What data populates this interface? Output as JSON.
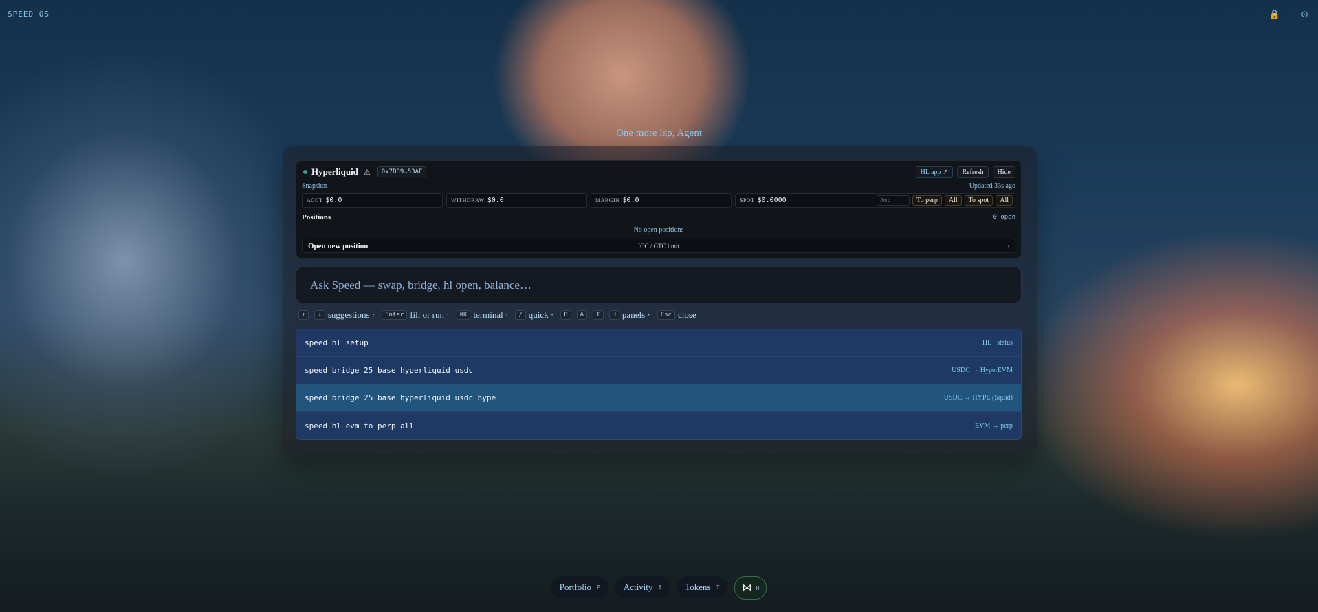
{
  "app": {
    "wordmark": "SPEED OS",
    "greeting": "One more lap, Agent"
  },
  "topbar": {
    "lock_glyph": "🔒",
    "status_glyph": "⊙"
  },
  "hl_panel": {
    "title": "Hyperliquid",
    "warn_glyph": "⚠",
    "address": "0x7B39…53AE",
    "hl_app_label": "HL app ↗",
    "refresh_label": "Refresh",
    "hide_label": "Hide",
    "snapshot_label": "Snapshot",
    "updated": "Updated 33s ago",
    "metrics": {
      "acct_label": "ACCT",
      "acct_value": "$0.0",
      "withdraw_label": "WITHDRAW",
      "withdraw_value": "$0.0",
      "margin_label": "MARGIN",
      "margin_value": "$0.0",
      "spot_label": "SPOT",
      "spot_value": "$0.0000"
    },
    "amt_placeholder": "Amt",
    "to_perp": "To perp",
    "all_1": "All",
    "to_spot": "To spot",
    "all_2": "All",
    "positions_label": "Positions",
    "positions_count": "0 open",
    "no_positions": "No open positions",
    "open_new": "Open new position",
    "order_mode": "IOC / GTC limit",
    "chevron": "›"
  },
  "ask": {
    "placeholder": "Ask Speed — swap, bridge, hl open, balance…"
  },
  "hints": {
    "up": "↑",
    "down": "↓",
    "suggestions": "suggestions ·",
    "enter": "Enter",
    "fill_or_run": "fill or run ·",
    "cmdk": "⌘K",
    "terminal": "terminal ·",
    "slash": "/",
    "quick": "quick ·",
    "p": "P",
    "a": "A",
    "t": "T",
    "h": "H",
    "panels": "panels ·",
    "esc": "Esc",
    "close": "close"
  },
  "suggestions": [
    {
      "cmd": "speed hl setup",
      "tag": "HL · status"
    },
    {
      "cmd": "speed bridge 25 base hyperliquid usdc",
      "tag": "USDC → HyperEVM"
    },
    {
      "cmd": "speed bridge 25 base hyperliquid usdc hype",
      "tag": "USDC → HYPE (Squid)"
    },
    {
      "cmd": "speed hl evm to perp all",
      "tag": "EVM → perp"
    }
  ],
  "dock": {
    "portfolio": "Portfolio",
    "portfolio_key": "P",
    "activity": "Activity",
    "activity_key": "A",
    "tokens": "Tokens",
    "tokens_key": "T",
    "brand_glyph": "⋈",
    "brand_key": "H"
  }
}
